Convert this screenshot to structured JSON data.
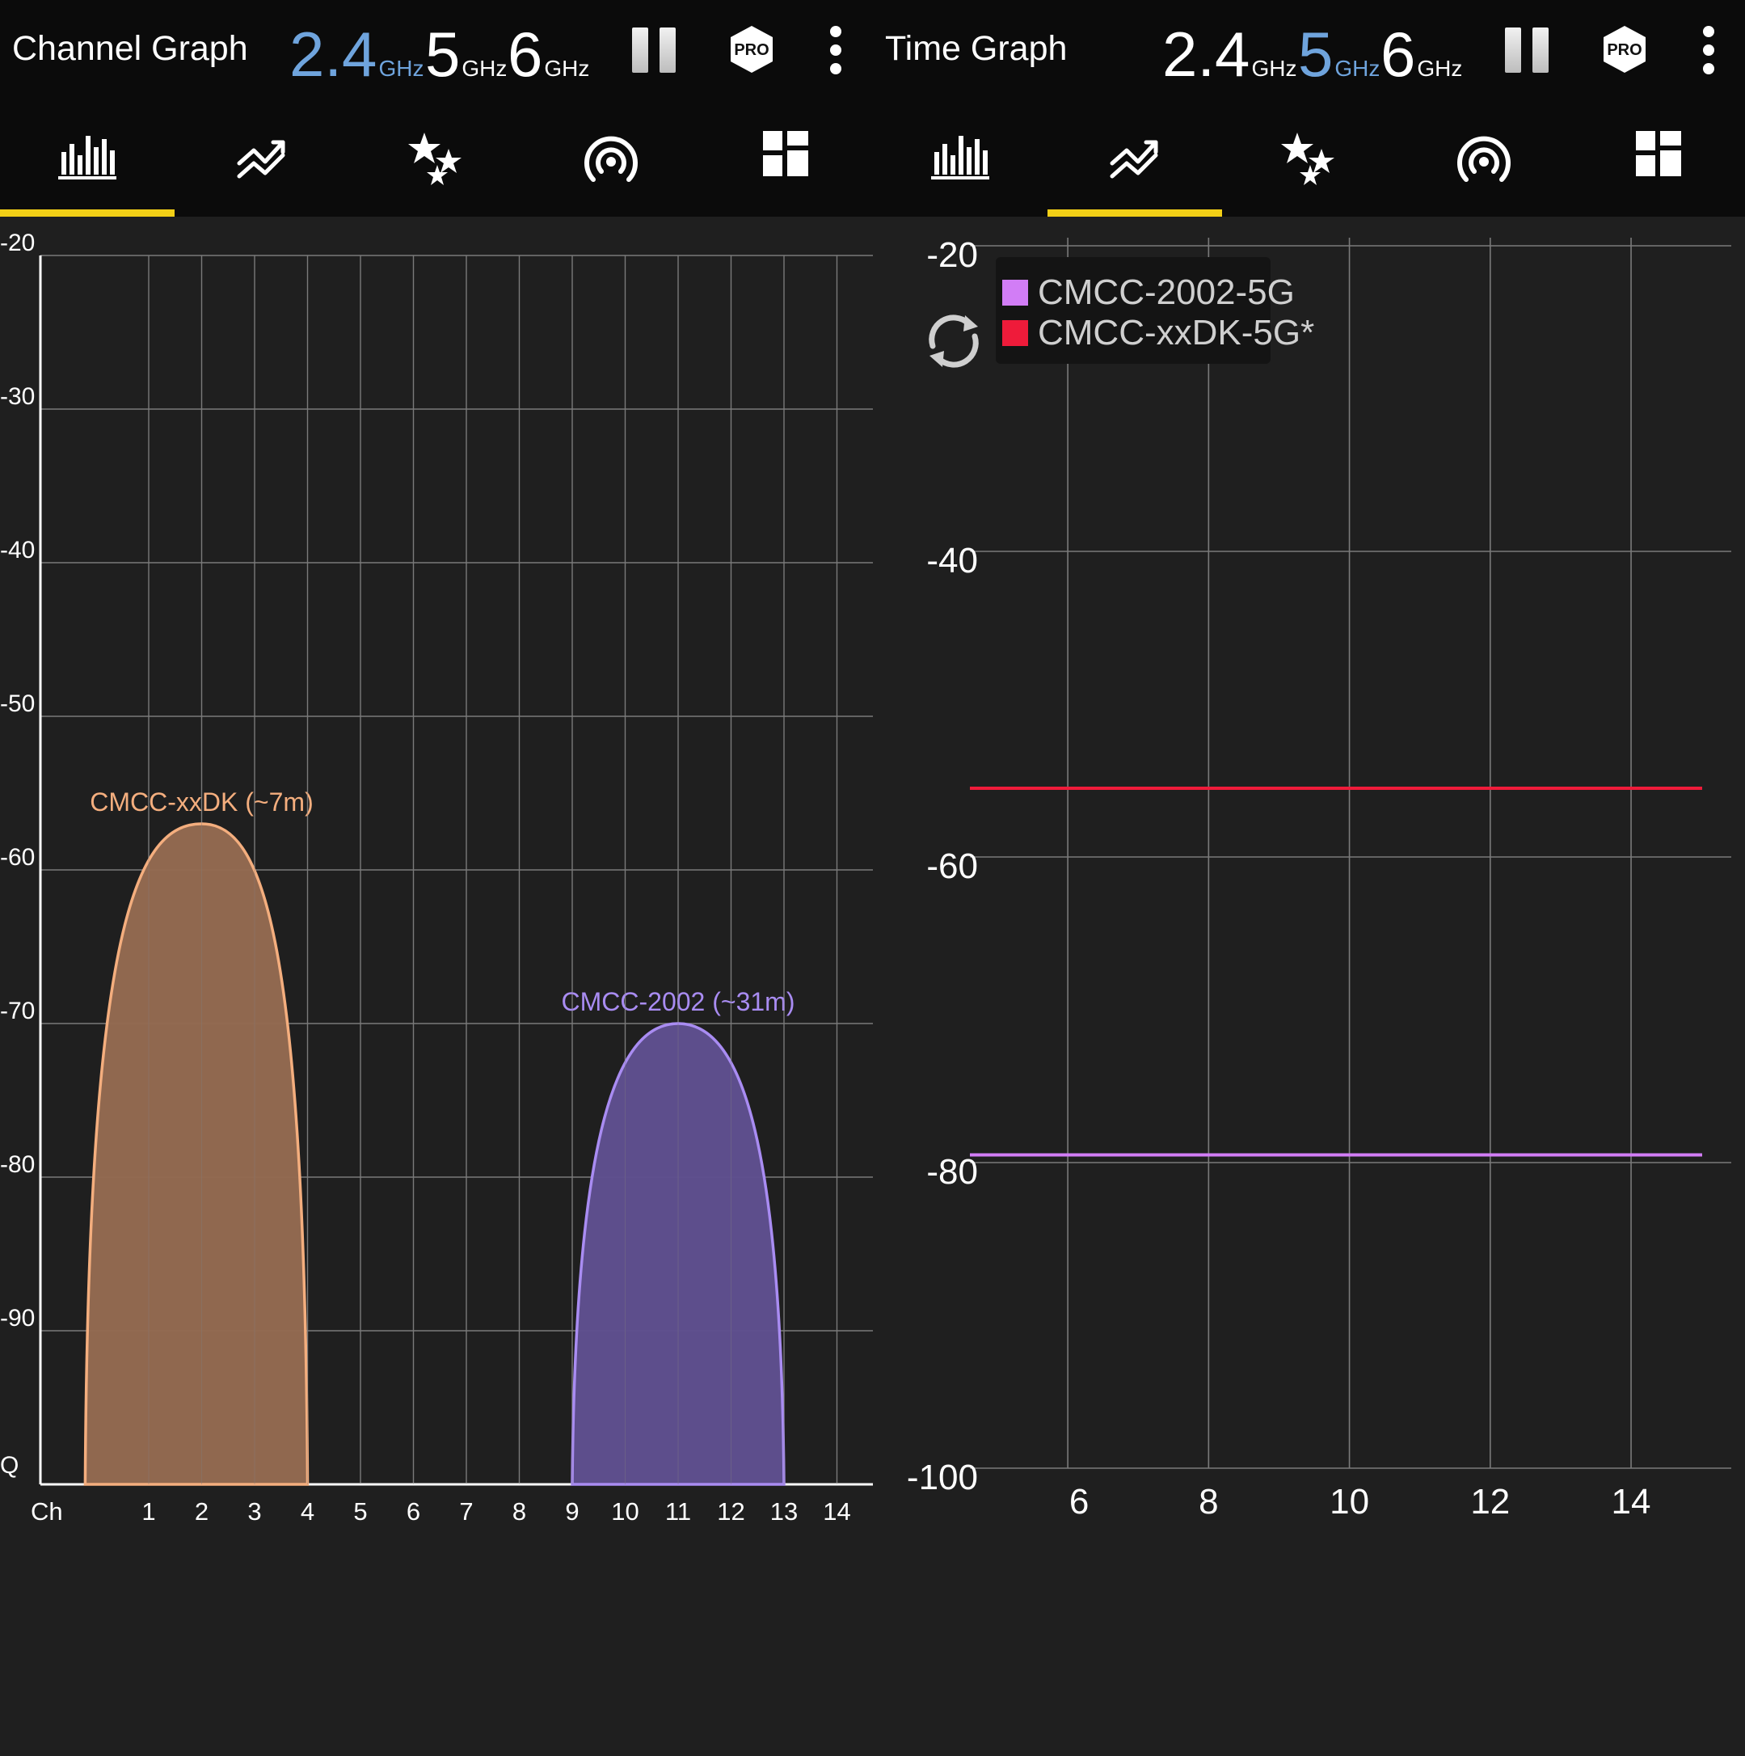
{
  "colors": {
    "accent_yellow": "#f2cf16",
    "band_active": "#6fa4dd",
    "background": "#1f1f1f",
    "bar_background": "#0b0b0b",
    "grid": "#7a7a7a",
    "series_orange_stroke": "#f4ae7e",
    "series_orange_fill": "#946a51",
    "series_purple_stroke": "#a98cf2",
    "series_purple_fill": "#5f4f90",
    "legend_purple": "#d27df6",
    "legend_red": "#ef1b3a"
  },
  "left": {
    "title": "Channel Graph",
    "bands": [
      {
        "value": "2.4",
        "unit": "GHz",
        "active": true
      },
      {
        "value": "5",
        "unit": "GHz",
        "active": false
      },
      {
        "value": "6",
        "unit": "GHz",
        "active": false
      }
    ],
    "pro_label": "PRO",
    "tabs": [
      {
        "icon": "bar-chart-icon",
        "selected": true
      },
      {
        "icon": "trend-line-icon",
        "selected": false
      },
      {
        "icon": "stars-icon",
        "selected": false
      },
      {
        "icon": "signal-access-point-icon",
        "selected": false
      },
      {
        "icon": "dashboard-grid-icon",
        "selected": false
      }
    ]
  },
  "right": {
    "title": "Time Graph",
    "bands": [
      {
        "value": "2.4",
        "unit": "GHz",
        "active": false
      },
      {
        "value": "5",
        "unit": "GHz",
        "active": true
      },
      {
        "value": "6",
        "unit": "GHz",
        "active": false
      }
    ],
    "pro_label": "PRO",
    "tabs": [
      {
        "icon": "bar-chart-icon",
        "selected": false
      },
      {
        "icon": "trend-line-icon",
        "selected": true
      },
      {
        "icon": "stars-icon",
        "selected": false
      },
      {
        "icon": "signal-access-point-icon",
        "selected": false
      },
      {
        "icon": "dashboard-grid-icon",
        "selected": false
      }
    ],
    "legend": [
      {
        "label": "CMCC-2002-5G",
        "color": "#d27df6"
      },
      {
        "label": "CMCC-xxDK-5G*",
        "color": "#ef1b3a"
      }
    ]
  },
  "chart_data": [
    {
      "type": "area",
      "y_ticks": [
        "-20",
        "-30",
        "-40",
        "-50",
        "-60",
        "-70",
        "-80",
        "-90",
        "Q"
      ],
      "y_tick_values": [
        -20,
        -30,
        -40,
        -50,
        -60,
        -70,
        -80,
        -90,
        -100
      ],
      "x_label": "Ch",
      "x_ticks": [
        "1",
        "2",
        "3",
        "4",
        "5",
        "6",
        "7",
        "8",
        "9",
        "10",
        "11",
        "12",
        "13",
        "14"
      ],
      "ylim": [
        -100,
        -20
      ],
      "xlim": [
        -1,
        14.5
      ],
      "grid": true,
      "series": [
        {
          "name": "CMCC-xxDK (~7m)",
          "center_channel": 2,
          "start_channel": -0.2,
          "end_channel": 4,
          "peak_dbm": -57,
          "stroke": "#f4ae7e",
          "fill": "#946a51"
        },
        {
          "name": "CMCC-2002 (~31m)",
          "center_channel": 11,
          "start_channel": 9,
          "end_channel": 13,
          "peak_dbm": -70,
          "stroke": "#a98cf2",
          "fill": "#5f4f90"
        }
      ]
    },
    {
      "type": "line",
      "y_ticks": [
        "-20",
        "-40",
        "-60",
        "-80",
        "-100"
      ],
      "y_tick_values": [
        -20,
        -40,
        -60,
        -80,
        -100
      ],
      "x_ticks": [
        "6",
        "8",
        "10",
        "12",
        "14"
      ],
      "x_tick_values": [
        6,
        8,
        10,
        12,
        14
      ],
      "ylim": [
        -100,
        -20
      ],
      "xlim": [
        5,
        15.4
      ],
      "grid": true,
      "legend_position": "top-left",
      "series": [
        {
          "name": "CMCC-2002-5G",
          "color": "#d27df6",
          "x": [
            5,
            15.4
          ],
          "values": [
            -79.5,
            -79.5
          ]
        },
        {
          "name": "CMCC-xxDK-5G*",
          "color": "#ef1b3a",
          "x": [
            5,
            15.4
          ],
          "values": [
            -55.5,
            -55.5
          ]
        }
      ]
    }
  ]
}
